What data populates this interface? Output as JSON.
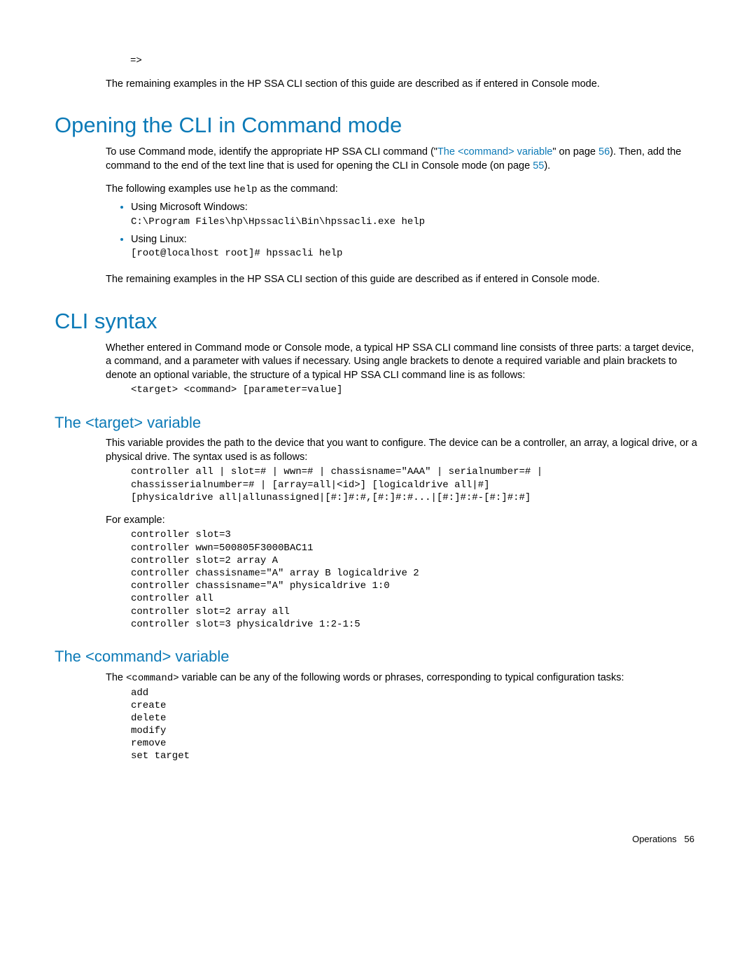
{
  "arrow_prompt": "=>",
  "intro_line": "The remaining examples in the HP SSA CLI section of this guide are described as if entered in Console mode.",
  "h1_open": "Opening the CLI in Command mode",
  "open_p1_a": "To use Command mode, identify the appropriate HP SSA CLI command (\"",
  "open_p1_link": "The <command> variable",
  "open_p1_b": "\" on page ",
  "open_p1_page": "56",
  "open_p1_c": "). Then, add the command to the end of the text line that is used for opening the CLI in Console mode (on page ",
  "open_p1_page2": "55",
  "open_p1_d": ").",
  "open_examples_intro_a": "The following examples use ",
  "open_examples_intro_code": "help",
  "open_examples_intro_b": " as the command:",
  "bullet_win_label": "Using Microsoft Windows:",
  "bullet_win_cmd": "C:\\Program Files\\hp\\Hpssacli\\Bin\\hpssacli.exe help",
  "bullet_lin_label": "Using Linux:",
  "bullet_lin_cmd": "[root@localhost root]# hpssacli help",
  "open_outro": "The remaining examples in the HP SSA CLI section of this guide are described as if entered in Console mode.",
  "h1_syntax": "CLI syntax",
  "syntax_p1": "Whether entered in Command mode or Console mode, a typical HP SSA CLI command line consists of three parts: a target device, a command, and a parameter with values if necessary. Using angle brackets to denote a required variable and plain brackets to denote an optional variable, the structure of a typical HP SSA CLI command line is as follows:",
  "syntax_code": "<target> <command> [parameter=value]",
  "h2_target": "The <target> variable",
  "target_p1": "This variable provides the path to the device that you want to configure. The device can be a controller, an array, a logical drive, or a physical drive. The syntax used is as follows:",
  "target_syntax_code": "controller all | slot=# | wwn=# | chassisname=\"AAA\" | serialnumber=# | \nchassisserialnumber=# | [array=all|<id>] [logicaldrive all|#] \n[physicaldrive all|allunassigned|[#:]#:#,[#:]#:#...|[#:]#:#-[#:]#:#]",
  "target_for_example": "For example:",
  "target_example_code": "controller slot=3\ncontroller wwn=500805F3000BAC11\ncontroller slot=2 array A\ncontroller chassisname=\"A\" array B logicaldrive 2\ncontroller chassisname=\"A\" physicaldrive 1:0\ncontroller all\ncontroller slot=2 array all\ncontroller slot=3 physicaldrive 1:2-1:5",
  "h2_command": "The <command> variable",
  "command_p1_a": "The ",
  "command_p1_code": "<command>",
  "command_p1_b": " variable can be any of the following words or phrases, corresponding to typical configuration tasks:",
  "command_list_code": "add\ncreate\ndelete\nmodify\nremove\nset target",
  "footer_label": "Operations",
  "footer_page": "56"
}
